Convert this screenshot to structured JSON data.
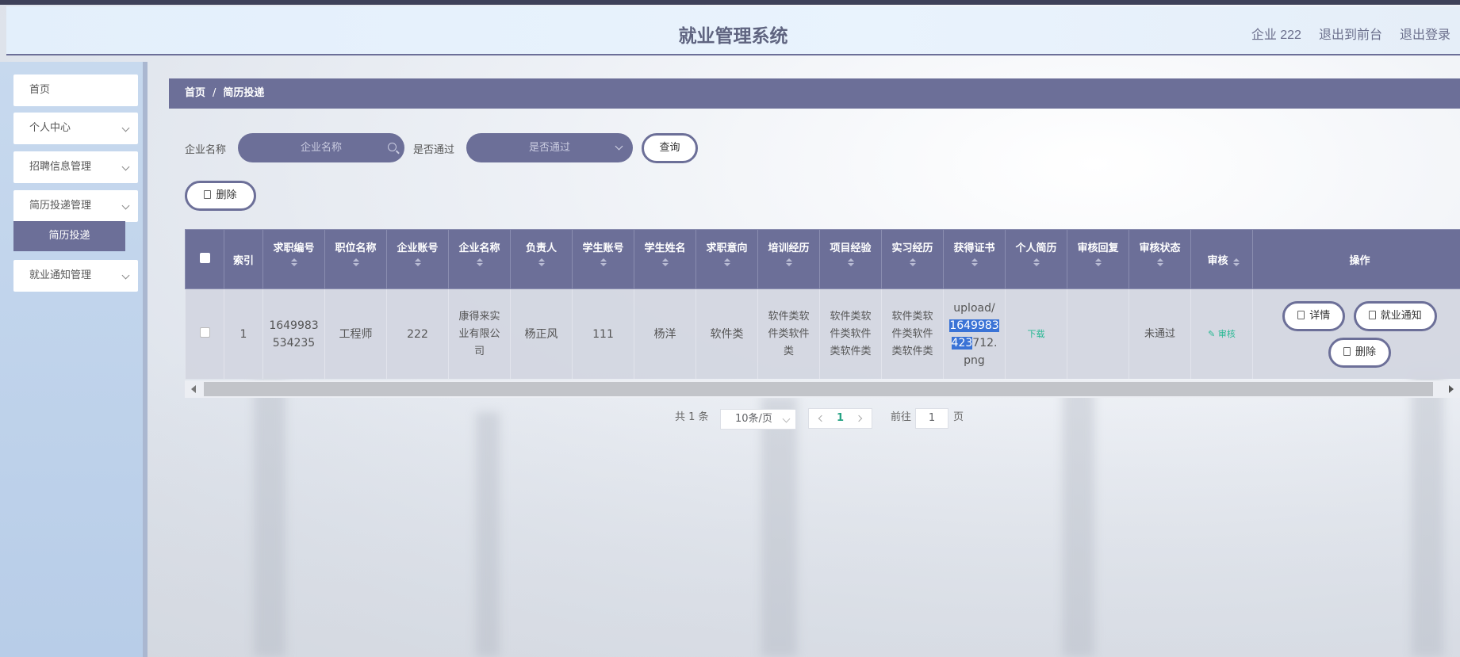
{
  "header": {
    "title": "就业管理系统",
    "user": "企业 222",
    "exit_front": "退出到前台",
    "logout": "退出登录"
  },
  "sidebar": {
    "items": [
      {
        "label": "首页"
      },
      {
        "label": "个人中心"
      },
      {
        "label": "招聘信息管理"
      },
      {
        "label": "简历投递管理"
      },
      {
        "label": "就业通知管理"
      }
    ],
    "active_sub": "简历投递"
  },
  "breadcrumb": {
    "home": "首页",
    "sep": "/",
    "current": "简历投递"
  },
  "filters": {
    "company_label": "企业名称",
    "company_placeholder": "企业名称",
    "passed_label": "是否通过",
    "passed_placeholder": "是否通过",
    "query": "查询",
    "delete": "删除"
  },
  "table": {
    "headers": [
      "索引",
      "求职编号",
      "职位名称",
      "企业账号",
      "企业名称",
      "负责人",
      "学生账号",
      "学生姓名",
      "求职意向",
      "培训经历",
      "项目经验",
      "实习经历",
      "获得证书",
      "个人简历",
      "审核回复",
      "审核状态",
      "审核",
      "操作"
    ],
    "row": {
      "index": "1",
      "job_no_1": "1649983",
      "job_no_2": "534235",
      "position": "工程师",
      "company_account": "222",
      "company_name_1": "康得来实",
      "company_name_2": "业有限公",
      "company_name_3": "司",
      "manager": "杨正风",
      "student_account": "111",
      "student_name": "杨洋",
      "intention": "软件类",
      "training_1": "软件类软",
      "training_2": "件类软件",
      "training_3": "类",
      "project_1": "软件类软",
      "project_2": "件类软件",
      "project_3": "类软件类",
      "intern_1": "软件类软",
      "intern_2": "件类软件",
      "intern_3": "类软件类",
      "cert_1": "upload/",
      "cert_2a": "1649983",
      "cert_3a": "423",
      "cert_3b": "712.",
      "cert_4": "png",
      "resume": "下载",
      "reply": "",
      "status": "未通过",
      "audit": "审核",
      "detail": "详情",
      "notice": "就业通知",
      "delete": "删除"
    }
  },
  "pagination": {
    "total": "共 1 条",
    "page_size": "10条/页",
    "current": "1",
    "goto": "前往",
    "goto_value": "1",
    "page_unit": "页"
  },
  "colors": {
    "accent": "#6c6f98",
    "link": "#27b893",
    "selection": "#3a73d6"
  }
}
